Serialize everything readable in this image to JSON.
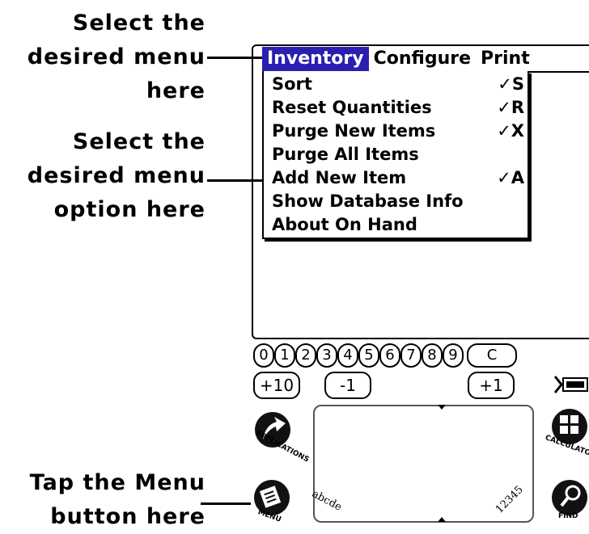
{
  "callouts": {
    "menu": [
      "Select the",
      "desired menu",
      "here"
    ],
    "option": [
      "Select the",
      "desired menu",
      "option here"
    ],
    "button": [
      "Tap the Menu",
      "button here"
    ]
  },
  "menubar": {
    "menus": [
      "Inventory",
      "Configure",
      "Print"
    ],
    "active": "Inventory"
  },
  "dropdown": {
    "items": [
      {
        "label": "Sort",
        "shortcut": "✓S"
      },
      {
        "label": "Reset Quantities",
        "shortcut": "✓R"
      },
      {
        "label": "Purge New Items",
        "shortcut": "✓X"
      },
      {
        "label": "Purge All Items",
        "shortcut": ""
      },
      {
        "label": "Add New Item",
        "shortcut": "✓A"
      },
      {
        "label": "Show Database Info",
        "shortcut": ""
      },
      {
        "label": "About On Hand",
        "shortcut": ""
      }
    ]
  },
  "keypad": {
    "digits": [
      "0",
      "1",
      "2",
      "3",
      "4",
      "5",
      "6",
      "7",
      "8",
      "9",
      "C"
    ],
    "increments": [
      "+10",
      "-1",
      "+1"
    ]
  },
  "silkscreen": {
    "applications_label": "APPLICATIONS",
    "menu_label": "MENU",
    "calculator_label": "CALCULATOR",
    "find_label": "FIND",
    "graffiti_left": "abcde",
    "graffiti_right": "12345"
  },
  "colors": {
    "active_menu": "#2b1fb0"
  }
}
